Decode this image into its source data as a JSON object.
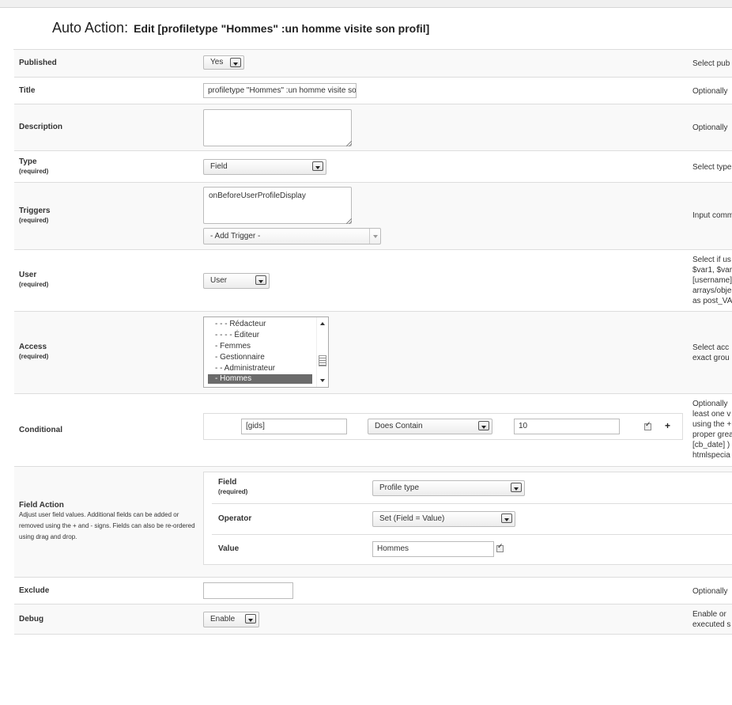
{
  "header": {
    "title_main": "Auto Action:",
    "title_sub": "Edit [profiletype \"Hommes\" :un homme visite son profil]"
  },
  "rows": {
    "published": {
      "label": "Published",
      "value": "Yes",
      "help": "Select pub"
    },
    "title": {
      "label": "Title",
      "value": "profiletype \"Hommes\" :un homme visite son profil",
      "help": "Optionally"
    },
    "description": {
      "label": "Description",
      "value": "",
      "help": "Optionally"
    },
    "type": {
      "label": "Type",
      "required": "(required)",
      "value": "Field",
      "help": "Select type"
    },
    "triggers": {
      "label": "Triggers",
      "required": "(required)",
      "value": "onBeforeUserProfileDisplay",
      "add_trigger": "- Add Trigger -",
      "help": "Input comm"
    },
    "user": {
      "label": "User",
      "required": "(required)",
      "value": "User",
      "help_lines": [
        "Select if us",
        "$var1, $var",
        "[username]",
        "arrays/obje",
        "as post_VA"
      ]
    },
    "access": {
      "label": "Access",
      "required": "(required)",
      "options": [
        "- - - Rédacteur",
        "- - - - Éditeur",
        "- Femmes",
        "- Gestionnaire",
        "- - Administrateur",
        "- Hommes"
      ],
      "selected_index": 5,
      "help_lines": [
        "Select acc",
        "exact grou"
      ]
    },
    "conditional": {
      "label": "Conditional",
      "field": "[gids]",
      "operator": "Does Contain",
      "value": "10",
      "add": "+",
      "help_lines": [
        "Optionally",
        "least one v",
        "using the +",
        "proper grea",
        "[cb_date] )",
        "htmlspecia"
      ]
    },
    "field_action": {
      "label": "Field Action",
      "description": "Adjust user field values. Additional fields can be added or removed using the + and - signs. Fields can also be re-ordered using drag and drop.",
      "field_label": "Field",
      "field_required": "(required)",
      "field_value": "Profile type",
      "operator_label": "Operator",
      "operator_value": "Set (Field = Value)",
      "value_label": "Value",
      "value_value": "Hommes"
    },
    "exclude": {
      "label": "Exclude",
      "value": "",
      "help": "Optionally"
    },
    "debug": {
      "label": "Debug",
      "value": "Enable",
      "help_lines": [
        "Enable or",
        "executed s"
      ]
    }
  }
}
